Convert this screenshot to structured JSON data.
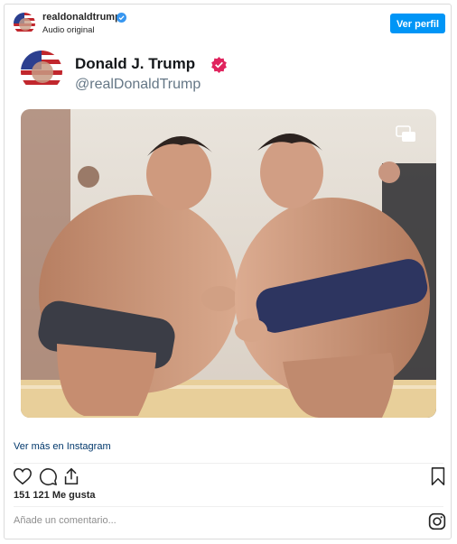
{
  "header": {
    "username": "realdonaldtrump",
    "subtitle": "Audio original",
    "follow_label": "Ver perfil"
  },
  "tweet": {
    "name": "Donald J. Trump",
    "handle": "@realDonaldTrump"
  },
  "footer": {
    "instagram_link": "Ver más en Instagram",
    "likes": "151 121 Me gusta",
    "comment_placeholder": "Añade un comentario..."
  },
  "colors": {
    "accent": "#0095f6",
    "verified_ig": "#3897f0",
    "verified_tw": "#e0245e"
  },
  "icons": [
    "flag-avatar",
    "verified-badge-icon",
    "gallery-icon",
    "heart-icon",
    "comment-icon",
    "share-icon",
    "bookmark-icon",
    "instagram-icon"
  ]
}
